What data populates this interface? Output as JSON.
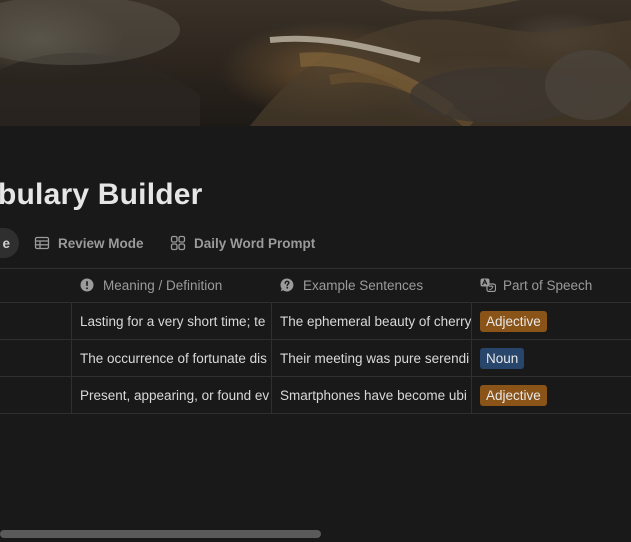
{
  "page_title": "bulary Builder",
  "tabs": [
    {
      "label": "e",
      "icon": "view-icon",
      "active": true
    },
    {
      "label": "Review Mode",
      "icon": "table-icon",
      "active": false
    },
    {
      "label": "Daily Word Prompt",
      "icon": "gallery-icon",
      "active": false
    }
  ],
  "table": {
    "columns": [
      {
        "label": "Meaning / Definition",
        "icon": "info-circle-icon"
      },
      {
        "label": "Example Sentences",
        "icon": "question-bubble-icon"
      },
      {
        "label": "Part of Speech",
        "icon": "translate-icon"
      }
    ],
    "rows": [
      {
        "meaning": "Lasting for a very short time; te",
        "example": "The ephemeral beauty of cherry",
        "pos": "Adjective"
      },
      {
        "meaning": "The occurrence of fortunate dis",
        "example": "Their meeting was pure serendi",
        "pos": "Noun"
      },
      {
        "meaning": "Present, appearing, or found ev",
        "example": "Smartphones have become ubi",
        "pos": "Adjective"
      }
    ]
  },
  "colors": {
    "background": "#191919",
    "tag_adjective": "#8a5318",
    "tag_noun": "#28456c"
  }
}
